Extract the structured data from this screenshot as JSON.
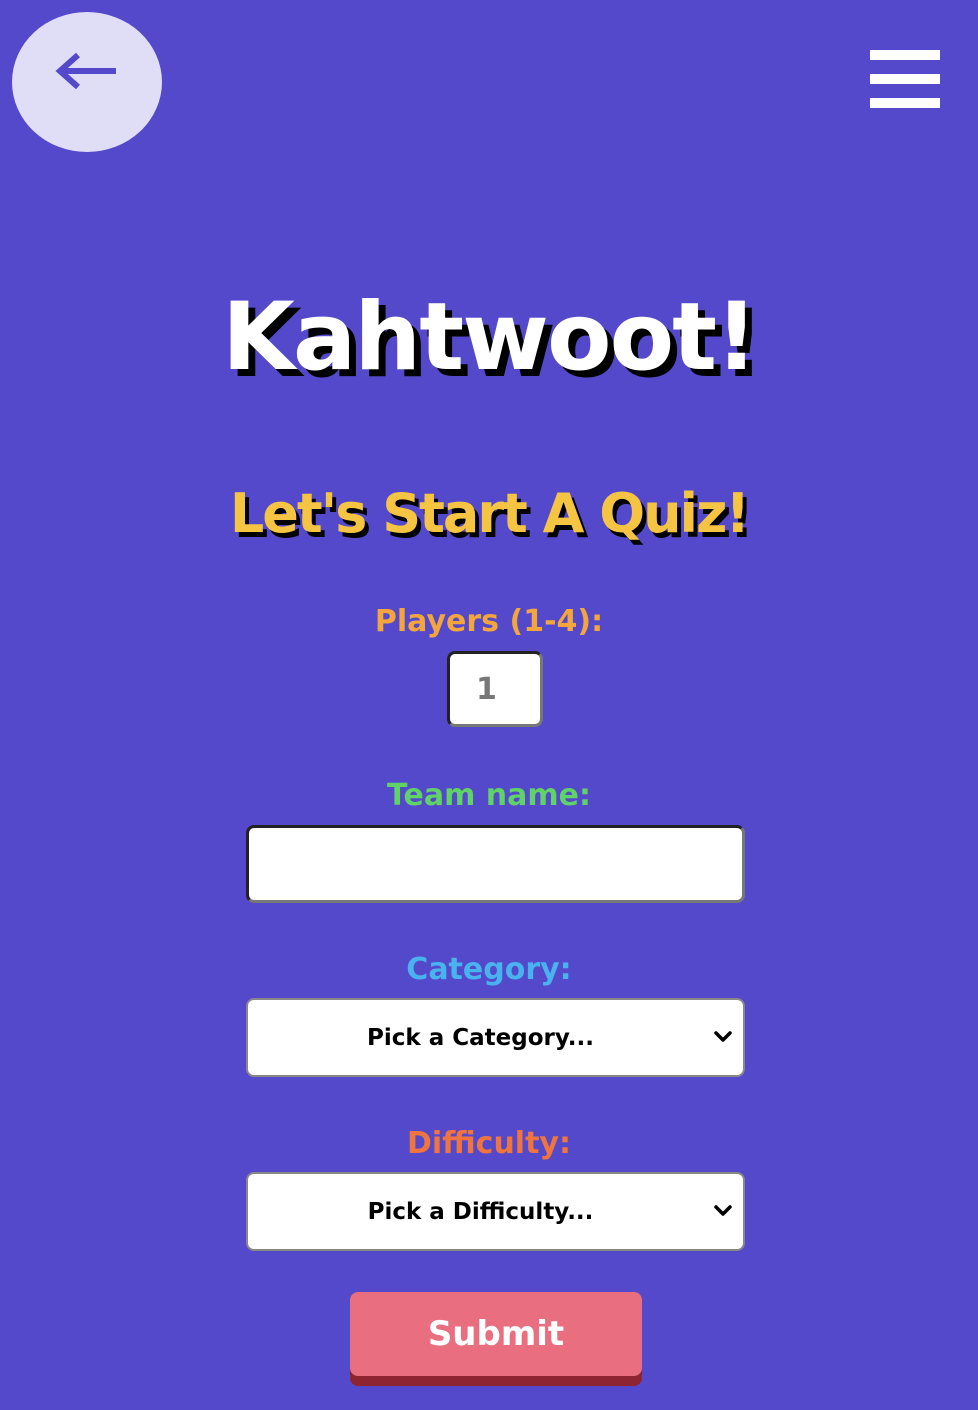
{
  "header": {
    "back_icon": "arrow-left-icon",
    "menu_icon": "hamburger-menu-icon"
  },
  "page": {
    "title": "Kahtwoot!",
    "subtitle": "Let's Start A Quiz!"
  },
  "form": {
    "players": {
      "label": "Players (1-4):",
      "value": "1"
    },
    "team": {
      "label": "Team name:",
      "value": ""
    },
    "category": {
      "label": "Category:",
      "selected": "Pick a Category..."
    },
    "difficulty": {
      "label": "Difficulty:",
      "selected": "Pick a Difficulty..."
    },
    "submit_label": "Submit"
  },
  "colors": {
    "background": "#5549cb",
    "back_button": "#e0ddf6",
    "subtitle": "#f5c443",
    "players_label": "#f4a63d",
    "team_label": "#5fd366",
    "category_label": "#49b3ee",
    "difficulty_label": "#f0743d",
    "submit": "#e96e80"
  }
}
